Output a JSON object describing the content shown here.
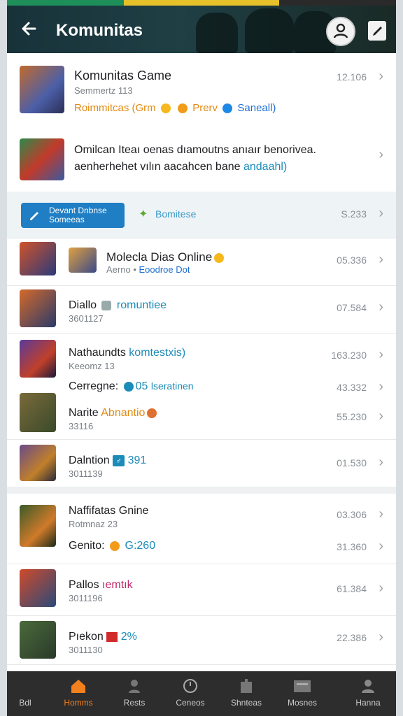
{
  "header": {
    "title": "Komunitas"
  },
  "featured": [
    {
      "name": "Komunitas Game",
      "sub": "Semmertz 113",
      "tags": "Roimmitcas (Grm",
      "tag2": "Prerv",
      "tag3": "Saneall)",
      "num": "12.106"
    },
    {
      "name": "Omilcan Iteaı oenas dıamoutns anıaır benorivea.",
      "line2": "aenherhehet vılın aacahcen bane",
      "line2b": "andaahl)",
      "num": ""
    }
  ],
  "promo": {
    "button": "Devant Dnbnse\nSomeeas",
    "label": "Bomitese",
    "num": "S.233"
  },
  "list": [
    {
      "name": "Molecla Dias Online",
      "sub": "Aerno",
      "sub2": "Eoodroe Dot",
      "num": "05.336"
    },
    {
      "name": "Diallo",
      "tag": "romuntiee",
      "sub": "3601127",
      "num": "07.584"
    },
    {
      "name": "Nathaundts",
      "tag": "komtestxis)",
      "sub": "Keeomz 13",
      "num": "163.230"
    },
    {
      "name": "Cerregne:",
      "tag": "05",
      "tag2": "lseratinen",
      "num": "43.332"
    },
    {
      "name": "Narite",
      "tag": "Abnantio",
      "sub": "33116",
      "num": "55.230"
    },
    {
      "name": "Dalntion",
      "tag": "391",
      "sub": "3011139",
      "num": "01.530"
    },
    {
      "name": "Naffifatas Gnine",
      "sub": "Rotmnaz 23",
      "num": "03.306"
    },
    {
      "name": "Genito:",
      "tag": "G:260",
      "num": "31.360"
    },
    {
      "name": "Pallos",
      "tag": "ıemtık",
      "sub": "3011196",
      "num": "61.384"
    },
    {
      "name": "Pıekon",
      "tag": "2%",
      "sub": "3011130",
      "num": "22.386"
    }
  ],
  "tabs": [
    {
      "label": "Bdl"
    },
    {
      "label": "Homms"
    },
    {
      "label": "Rests"
    },
    {
      "label": "Ceneos"
    },
    {
      "label": "Shnteas"
    },
    {
      "label": "Mosnes"
    },
    {
      "label": "Hanna"
    }
  ],
  "icons": [
    "back-arrow-icon",
    "profile-icon",
    "edit-icon",
    "chevron-right-icon",
    "chat-icon",
    "home-icon",
    "person-icon",
    "clock-icon",
    "store-icon",
    "message-icon",
    "user-icon"
  ],
  "colors": {
    "accent": "#f2801e",
    "teal": "#1b8bb8",
    "header_bg": "#1f3f45"
  }
}
